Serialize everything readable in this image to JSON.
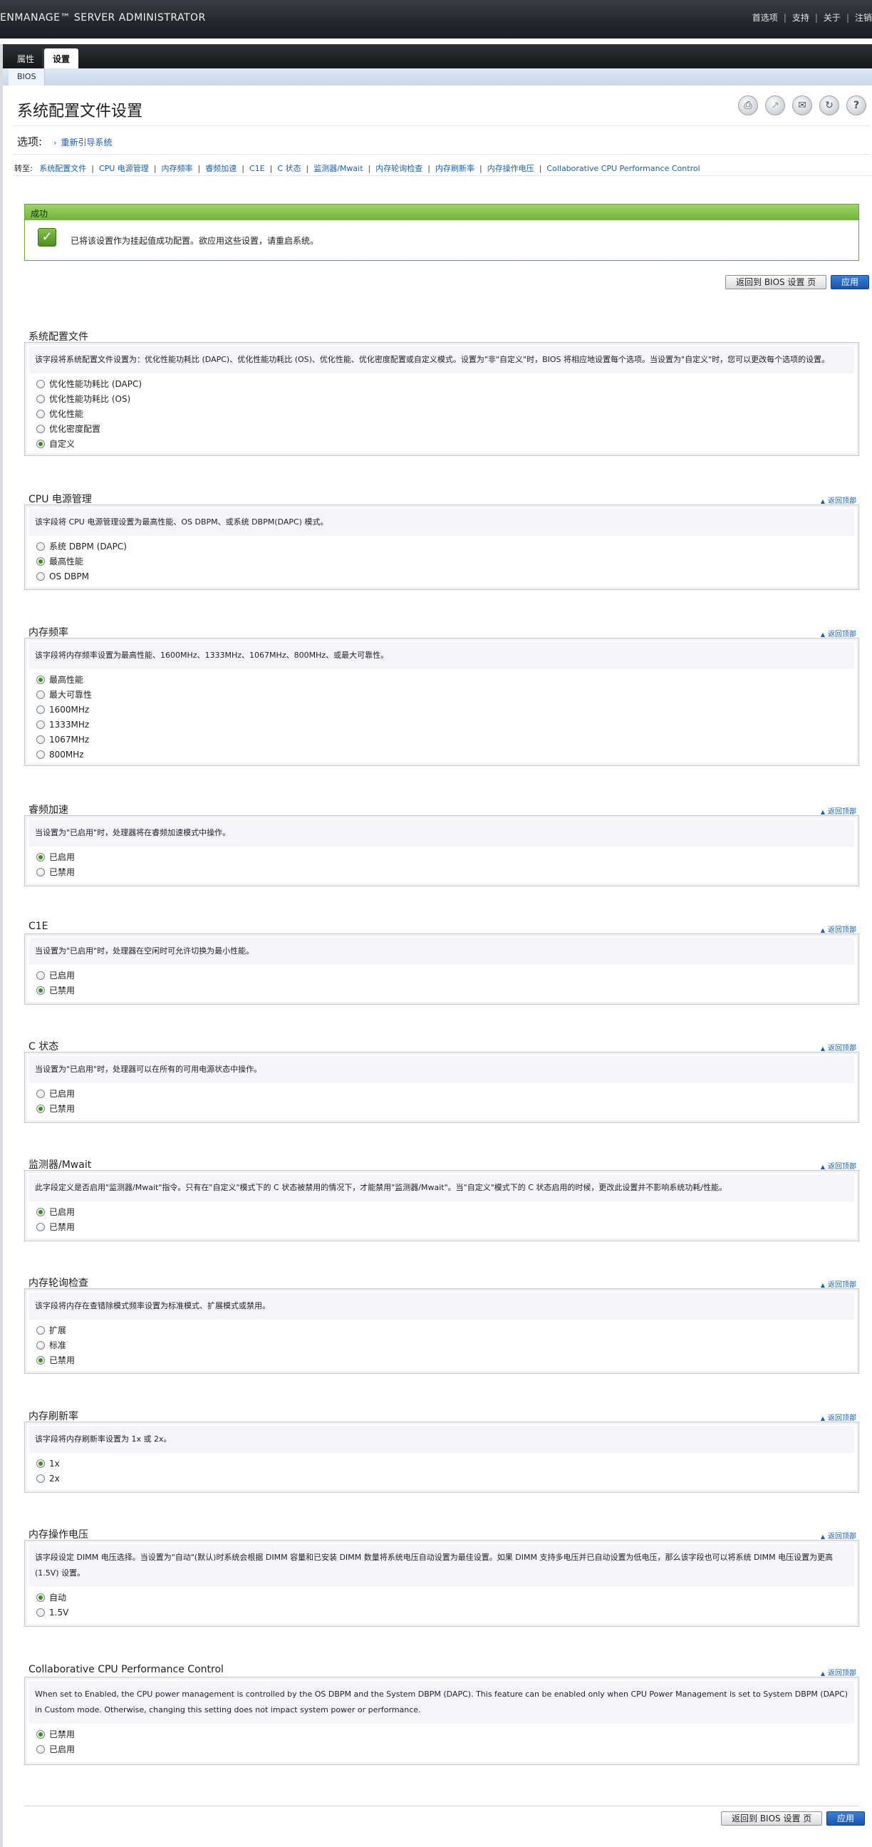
{
  "header": {
    "brand": "ENMANAGE™ SERVER ADMINISTRATOR",
    "links": [
      "首选项",
      "支持",
      "关于",
      "注销"
    ]
  },
  "tabs": [
    "属性",
    "设置"
  ],
  "subtab": "BIOS",
  "page": {
    "title": "系统配置文件设置",
    "tool_icons": [
      "print-icon",
      "export-icon",
      "email-icon",
      "refresh-icon",
      "help-icon"
    ],
    "options_label": "选项:",
    "reboot_link": "重新引导系统",
    "jump_label": "转至:",
    "jump_links": [
      "系统配置文件",
      "CPU 电源管理",
      "内存频率",
      "睿频加速",
      "C1E",
      "C 状态",
      "监测器/Mwait",
      "内存轮询检查",
      "内存刷新率",
      "内存操作电压",
      "Collaborative CPU Performance Control"
    ]
  },
  "success": {
    "title": "成功",
    "message": "已将该设置作为挂起值成功配置。欲应用这些设置，请重启系统。"
  },
  "buttons": {
    "back": "返回到 BIOS 设置 页",
    "apply": "应用"
  },
  "back_to_top": "返回顶部",
  "sections": [
    {
      "title": "系统配置文件",
      "desc": "该字段将系统配置文件设置为：优化性能功耗比 (DAPC)、优化性能功耗比 (OS)、优化性能、优化密度配置或自定义模式。设置为\"非\"自定义\"时，BIOS 将相应地设置每个选项。当设置为\"自定义\"时，您可以更改每个选项的设置。",
      "options": [
        "优化性能功耗比 (DAPC)",
        "优化性能功耗比 (OS)",
        "优化性能",
        "优化密度配置",
        "自定义"
      ],
      "selected": 4
    },
    {
      "title": "CPU 电源管理",
      "desc": "该字段将 CPU 电源管理设置为最高性能、OS DBPM、或系统 DBPM(DAPC) 模式。",
      "options": [
        "系统 DBPM (DAPC)",
        "最高性能",
        "OS DBPM"
      ],
      "selected": 1
    },
    {
      "title": "内存频率",
      "desc": "该字段将内存频率设置为最高性能、1600MHz、1333MHz、1067MHz、800MHz、或最大可靠性。",
      "options": [
        "最高性能",
        "最大可靠性",
        "1600MHz",
        "1333MHz",
        "1067MHz",
        "800MHz"
      ],
      "selected": 0
    },
    {
      "title": "睿频加速",
      "desc": "当设置为\"已启用\"时，处理器将在睿频加速模式中操作。",
      "options": [
        "已启用",
        "已禁用"
      ],
      "selected": 0
    },
    {
      "title": "C1E",
      "desc": "当设置为\"已启用\"时，处理器在空闲时可允许切换为最小性能。",
      "options": [
        "已启用",
        "已禁用"
      ],
      "selected": 1
    },
    {
      "title": "C 状态",
      "desc": "当设置为\"已启用\"时，处理器可以在所有的可用电源状态中操作。",
      "options": [
        "已启用",
        "已禁用"
      ],
      "selected": 1
    },
    {
      "title": "监测器/Mwait",
      "desc": "此字段定义是否启用\"监测器/Mwait\"指令。只有在\"自定义\"模式下的 C 状态被禁用的情况下，才能禁用\"监测器/Mwait\"。当\"自定义\"模式下的 C 状态启用的时候，更改此设置并不影响系统功耗/性能。",
      "options": [
        "已启用",
        "已禁用"
      ],
      "selected": 0
    },
    {
      "title": "内存轮询检查",
      "desc": "该字段将内存在查错除模式频率设置为标准模式、扩展模式或禁用。",
      "options": [
        "扩展",
        "标准",
        "已禁用"
      ],
      "selected": 2
    },
    {
      "title": "内存刷新率",
      "desc": "该字段将内存刷新率设置为 1x 或 2x。",
      "options": [
        "1x",
        "2x"
      ],
      "selected": 0
    },
    {
      "title": "内存操作电压",
      "desc": "该字段设定 DIMM 电压选择。当设置为\"自动\"(默认)时系统会根据 DIMM 容量和已安装 DIMM 数量将系统电压自动设置为最佳设置。如果 DIMM 支持多电压并已自动设置为低电压，那么该字段也可以将系统 DIMM 电压设置为更高 (1.5V) 设置。",
      "options": [
        "自动",
        "1.5V"
      ],
      "selected": 0
    },
    {
      "title": "Collaborative CPU Performance Control",
      "desc": "When set to Enabled, the CPU power management is controlled by the OS DBPM and the System DBPM (DAPC). This feature can be enabled only when CPU Power Management is set to System DBPM (DAPC) in Custom mode. Otherwise, changing this setting does not impact system power or performance.",
      "options": [
        "已禁用",
        "已启用"
      ],
      "selected": 0
    }
  ]
}
